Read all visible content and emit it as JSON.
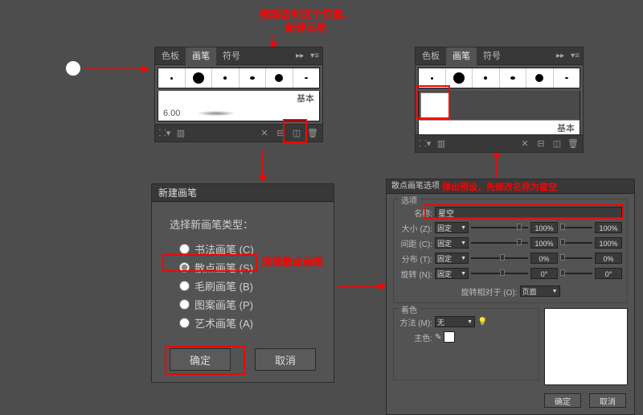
{
  "anno": {
    "top": "拖动圆到这个位置，\n新建画笔",
    "select_scatter": "选择散点画笔",
    "popup_preset": "弹出预设，先修改名称为星空"
  },
  "brushes_panel": {
    "tabs": {
      "swatches": "色板",
      "brushes": "画笔",
      "symbols": "符号"
    },
    "basic_label": "基本",
    "ruler_val": "6.00"
  },
  "new_brush_dialog": {
    "title": "新建画笔",
    "prompt": "选择新画笔类型：",
    "options": {
      "calligraphic": "书法画笔 (C)",
      "scatter": "散点画笔 (S)",
      "bristle": "毛刷画笔 (B)",
      "pattern": "图案画笔 (P)",
      "art": "艺术画笔 (A)"
    },
    "ok": "确定",
    "cancel": "取消"
  },
  "options_dialog": {
    "title": "散点画笔选项",
    "group_options": "选项",
    "name_label": "名称:",
    "name_value": "星空",
    "size": "大小 (Z):",
    "spacing": "间距 (C):",
    "scatter": "分布 (T):",
    "rotation": "旋转 (N):",
    "fixed": "固定",
    "pct100": "100%",
    "pct0": "0%",
    "deg0": "0°",
    "rotation_rel": "旋转相对于 (O):",
    "page": "页面",
    "group_color": "着色",
    "method": "方法 (M):",
    "none": "无",
    "keycolor": "主色:",
    "ok": "确定",
    "cancel": "取消"
  }
}
